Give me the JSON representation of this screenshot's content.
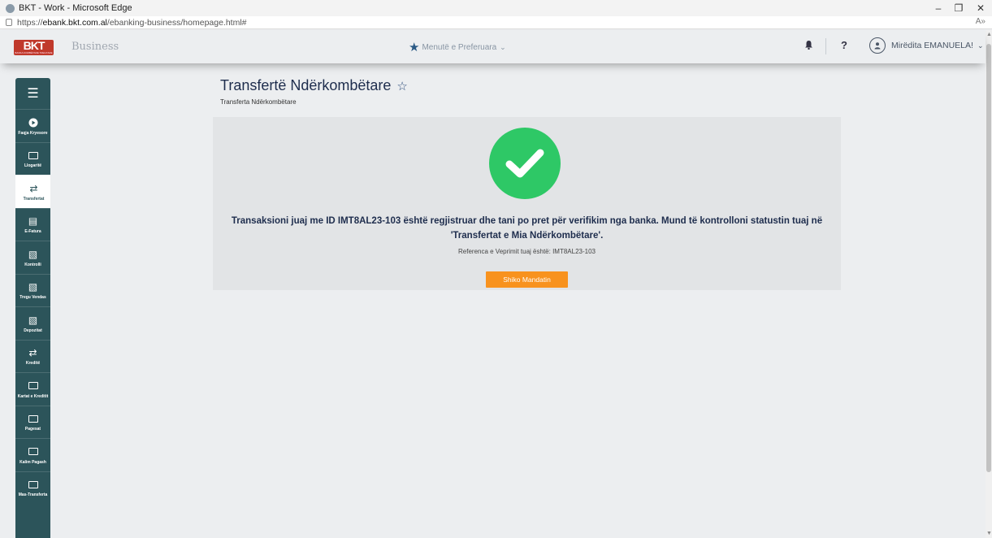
{
  "browser": {
    "title": "BKT - Work - Microsoft Edge",
    "url_prefix": "https://",
    "url_domain": "ebank.bkt.com.al",
    "url_path": "/ebanking-business/homepage.html#",
    "minimize": "–",
    "restore": "❐",
    "close": "✕",
    "read_aloud": "A»"
  },
  "header": {
    "logo": "BKT",
    "logo_sub": "BANKA KOMBËTARE TREGTARE",
    "business": "Business",
    "favorites_label": "Menutë e Preferuara",
    "help": "?",
    "user_greeting": "Mirëdita EMANUELA!"
  },
  "sidebar": {
    "menu_icon": "menu-icon",
    "items": [
      {
        "label": "Faqja Kryesore",
        "icon": "home-icon",
        "active": false
      },
      {
        "label": "Llogaritë",
        "icon": "accounts-icon",
        "active": false
      },
      {
        "label": "Transfertat",
        "icon": "transfer-icon",
        "active": true
      },
      {
        "label": "E-Fatura",
        "icon": "invoice-icon",
        "active": false
      },
      {
        "label": "Kontrolli",
        "icon": "control-icon",
        "active": false
      },
      {
        "label": "Tregu Vendas",
        "icon": "market-icon",
        "active": false
      },
      {
        "label": "Depozitat",
        "icon": "deposit-icon",
        "active": false
      },
      {
        "label": "Kreditë",
        "icon": "credit-icon",
        "active": false
      },
      {
        "label": "Kartat e Kreditit",
        "icon": "card-icon",
        "active": false
      },
      {
        "label": "Pagesat",
        "icon": "payment-icon",
        "active": false
      },
      {
        "label": "Kalim Pagash",
        "icon": "payroll-icon",
        "active": false
      },
      {
        "label": "Mas-Transferta",
        "icon": "mass-transfer-icon",
        "active": false
      }
    ]
  },
  "main": {
    "title": "Transfertë Ndërkombëtare",
    "subtitle": "Transferta Ndërkombëtare",
    "success_message": "Transaksioni juaj me ID IMT8AL23-103 është regjistruar dhe tani po pret për verifikim nga banka. Mund të kontrolloni statustin tuaj në 'Transfertat e Mia Ndërkombëtare'.",
    "reference_text": "Referenca e Veprimit tuaj është: IMT8AL23-103",
    "button_label": "Shiko Mandatin"
  },
  "colors": {
    "sidebar": "#2c545a",
    "success": "#2ec866",
    "button": "#f8921e",
    "logo": "#c0392b"
  }
}
